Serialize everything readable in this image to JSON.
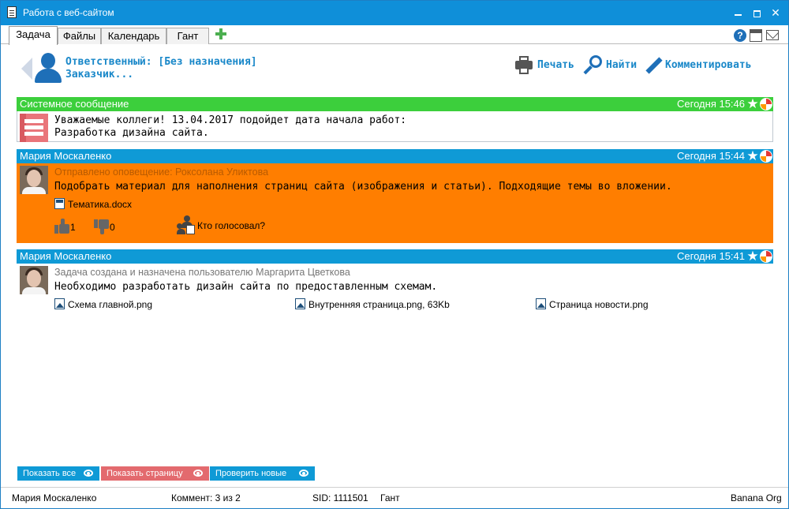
{
  "window": {
    "title": "Работа с веб-сайтом",
    "accent_color": "#0f8fd9"
  },
  "tabs": [
    {
      "label": "Задача",
      "active": true
    },
    {
      "label": "Файлы",
      "active": false
    },
    {
      "label": "Календарь",
      "active": false
    },
    {
      "label": "Гант",
      "active": false
    }
  ],
  "header": {
    "assignee": "Ответственный: [Без назначения]",
    "customer": "Заказчик...",
    "actions": {
      "print": "Печать",
      "find": "Найти",
      "comment": "Комментировать"
    }
  },
  "messages": [
    {
      "author": "Системное сообщение",
      "time": "Сегодня 15:46",
      "header_color": "#3ccf3c",
      "lines": [
        "Уважаемые коллеги! 13.04.2017 подойдет дата начала работ:",
        "Разработка дизайна сайта."
      ]
    },
    {
      "author": "Мария Москаленко",
      "time": "Сегодня 15:44",
      "header_color": "#0f9ad6",
      "body_color": "#ff7e00",
      "meta": "Отправлено оповещение: Роксолана Уликтова",
      "text": "Подобрать материал для наполнения страниц сайта (изображения и статьи). Подходящие темы во вложении.",
      "attachment": "Тематика.docx",
      "likes": "1",
      "dislikes": "0",
      "voters_link": "Кто голосовал?"
    },
    {
      "author": "Мария Москаленко",
      "time": "Сегодня 15:41",
      "header_color": "#0f9ad6",
      "meta": "Задача создана и назначена пользователю Маргарита Цветкова",
      "text": "Необходимо разработать дизайн сайта по предоставленным схемам.",
      "attachments": [
        "Схема главной.png",
        "Внутренняя страница.png, 63Kb",
        "Страница новости.png"
      ]
    }
  ],
  "buttons": {
    "show_all": "Показать все",
    "show_page": "Показать страницу",
    "check_new": "Проверить новые"
  },
  "statusbar": {
    "user": "Мария Москаленко",
    "comments": "Коммент: 3 из 2",
    "sid": "SID: 1111501",
    "view": "Гант",
    "org": "Banana Org"
  }
}
